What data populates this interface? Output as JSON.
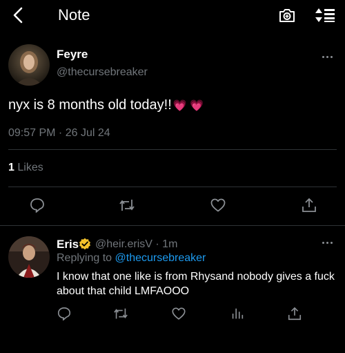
{
  "header": {
    "title": "Note",
    "back_icon": "chevron-left-icon",
    "camera_icon": "camera-icon",
    "sort_icon": "sort-icon"
  },
  "tweet": {
    "author_name": "Feyre",
    "author_handle": "@thecursebreaker",
    "text": "nyx is 8 months old today!!",
    "emoji": "💗 💗",
    "timestamp": "09:57 PM · 26 Jul 24",
    "likes_count": "1",
    "likes_label": "Likes",
    "actions": [
      "reply-icon",
      "retweet-icon",
      "like-icon",
      "share-icon"
    ]
  },
  "reply": {
    "author_name": "Eris",
    "author_handle": "@heir.erisV",
    "time_ago": "· 1m",
    "replying_prefix": "Replying to",
    "replying_handle": "@thecursebreaker",
    "text": "I know that one like is from Rhysand nobody gives a fuck about that child LMFAOOO",
    "actions": [
      "reply-icon",
      "retweet-icon",
      "like-icon",
      "views-icon",
      "share-icon"
    ]
  },
  "colors": {
    "background": "#000000",
    "text_primary": "#ffffff",
    "text_secondary": "#71767b",
    "link": "#1d9bf0",
    "verified_badge": "#f4c22b",
    "divider": "#2f3336"
  }
}
